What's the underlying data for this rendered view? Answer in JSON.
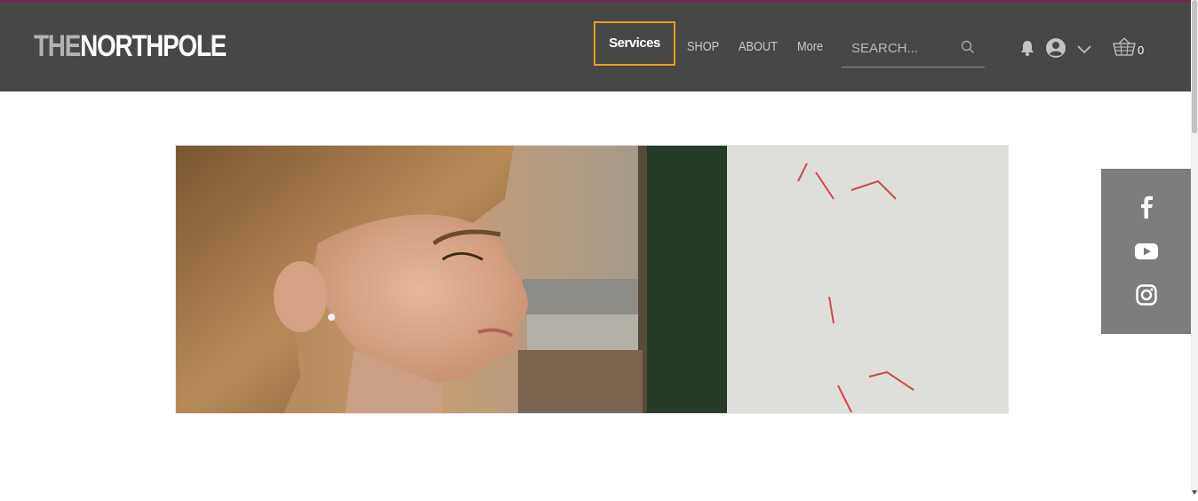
{
  "logo": {
    "part1": "THE",
    "part2": "NORTHPOLE"
  },
  "nav": {
    "items": [
      "Services",
      "SHOP",
      "ABOUT",
      "More"
    ],
    "active": "Services"
  },
  "search": {
    "placeholder": "SEARCH..."
  },
  "cart": {
    "count": "0"
  },
  "icons": {
    "header": [
      "search-icon",
      "bell-icon",
      "user-avatar-icon",
      "chevron-down-icon",
      "cart-basket-icon"
    ],
    "social": [
      "facebook-icon",
      "youtube-icon",
      "instagram-icon"
    ]
  },
  "colors": {
    "header_bg": "#474746",
    "top_line": "#7a1f5c",
    "active_outline": "#e3a21a",
    "social_bar_bg": "#7d7d7d"
  }
}
